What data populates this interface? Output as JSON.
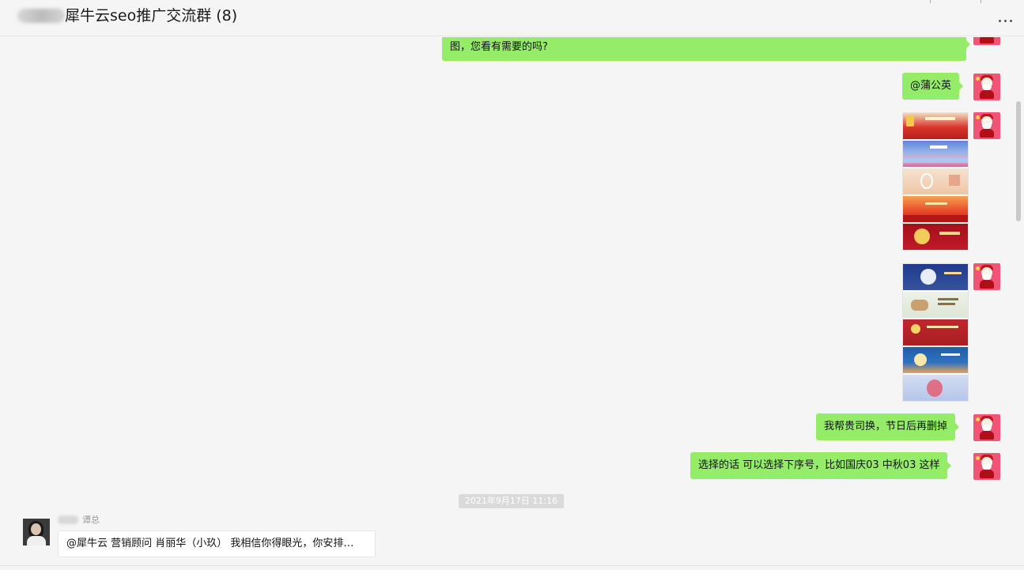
{
  "header": {
    "title": "犀牛云seo推广交流群 (8)",
    "more_icon": "more-dots-icon"
  },
  "messages_me": [
    {
      "text": "图，您看有需要的吗?"
    },
    {
      "text": "@蒲公英"
    },
    {
      "text": "我帮贵司换，节日后再删掉"
    },
    {
      "text": "选择的话 可以选择下序号，比如国庆03  中秋03 这样"
    }
  ],
  "image_groups": [
    {
      "images": [
        "national-day-banner-01",
        "national-day-banner-02",
        "national-day-banner-03",
        "national-day-banner-04",
        "national-day-banner-05"
      ]
    },
    {
      "images": [
        "mid-autumn-banner-01",
        "mid-autumn-banner-02",
        "mid-autumn-banner-03",
        "mid-autumn-banner-04",
        "mid-autumn-banner-05"
      ]
    }
  ],
  "timestamp": "2021年9月17日 11:16",
  "incoming": {
    "sender_suffix": "谭总",
    "text": "@犀牛云 营销顾问 肖丽华（小玖） 我相信你得眼光，你安排…"
  },
  "colors": {
    "bubble_me": "#95ec69",
    "bubble_other": "#ffffff",
    "avatar_bg": "#f15575",
    "background": "#f5f5f5"
  }
}
